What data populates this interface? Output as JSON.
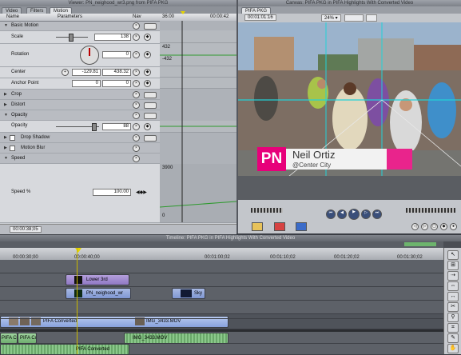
{
  "viewer": {
    "title": "Viewer: PN_neighood_wr3.png from PIFA PKG",
    "tabs": [
      "Video",
      "Filters",
      "Motion"
    ],
    "col_name": "Name",
    "col_params": "Parameters",
    "col_nav": "Nav",
    "ruler_left": "36:00",
    "ruler_right": "00:00:42",
    "timecode": "00:00:38;05",
    "basic_motion": "Basic Motion",
    "scale_label": "Scale",
    "scale_value": "138",
    "rotation_label": "Rotation",
    "rotation_value": "0",
    "rot_kf_top": "432",
    "rot_kf_bottom": "-432",
    "center_label": "Center",
    "center_x": "-129.81",
    "center_y": "438.32",
    "anchor_label": "Anchor Point",
    "anchor_x": "0",
    "anchor_y": "0",
    "crop": "Crop",
    "distort": "Distort",
    "opacity_section": "Opacity",
    "opacity_label": "Opacity",
    "opacity_value": "88",
    "drop_shadow": "Drop Shadow",
    "motion_blur": "Motion Blur",
    "speed_section": "Speed",
    "speed_label": "Speed %",
    "speed_value": "100.00",
    "speed_kf_top": "3900",
    "speed_kf_bottom": "0"
  },
  "canvas": {
    "title": "Canvas: PIFA PKG in PIFA Highlights With Converted Video",
    "tab": "PIFA PKG",
    "timecode": "00:01:01:16",
    "zoom": "24%",
    "lower_third": {
      "logo": "PN",
      "name": "Neil Ortiz",
      "handle": "@Center City"
    }
  },
  "timeline": {
    "title": "Timeline: PIFA PKG in PIFA Highlights With Converted Video",
    "ruler_labels": [
      "00:00:30;00",
      "00:00:40;00",
      "00:01:00;02",
      "00:01:10;02",
      "00:01:20;02",
      "00:01:30;02"
    ],
    "clips": {
      "lower3rd": "Lower 3rd",
      "neighood": "PN_neighood_wr",
      "sky": "Sky",
      "pifa_conv": "PIFA Converted",
      "img_mov": "IMG_3433.MOV",
      "pifa_conv_a1": "PIFA Conve",
      "pifa_c_a1": "PIFA Cc",
      "img_mov_a": "IMG_3433.MOV",
      "pifa_conv_a2": "PIFA Converted"
    }
  }
}
